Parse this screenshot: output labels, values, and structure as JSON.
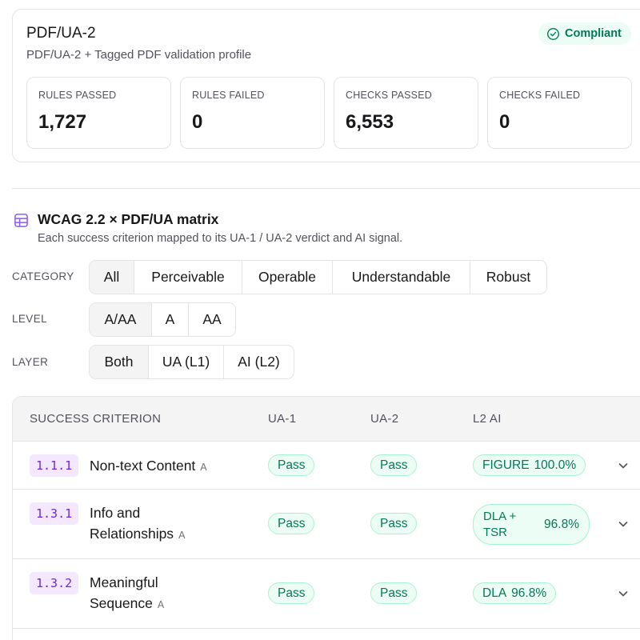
{
  "profile": {
    "title": "PDF/UA-2",
    "subtitle": "PDF/UA-2 + Tagged PDF validation profile",
    "status": "Compliant",
    "stats": [
      {
        "label": "RULES PASSED",
        "value": "1,727"
      },
      {
        "label": "RULES FAILED",
        "value": "0"
      },
      {
        "label": "CHECKS PASSED",
        "value": "6,553"
      },
      {
        "label": "CHECKS FAILED",
        "value": "0"
      }
    ]
  },
  "matrix": {
    "title": "WCAG 2.2 × PDF/UA matrix",
    "subtitle": "Each success criterion mapped to its UA-1 / UA-2 verdict and AI signal."
  },
  "filters": {
    "category": {
      "label": "CATEGORY",
      "options": [
        "All",
        "Perceivable",
        "Operable",
        "Understandable",
        "Robust"
      ],
      "selected": "All"
    },
    "level": {
      "label": "LEVEL",
      "options": [
        "A/AA",
        "A",
        "AA"
      ],
      "selected": "A/AA"
    },
    "layer": {
      "label": "LAYER",
      "options": [
        "Both",
        "UA (L1)",
        "AI (L2)"
      ],
      "selected": "Both"
    }
  },
  "table": {
    "headers": {
      "criterion": "SUCCESS CRITERION",
      "ua1": "UA-1",
      "ua2": "UA-2",
      "ai": "L2 AI"
    },
    "rows": [
      {
        "code": "1.1.1",
        "name_line1": "Non-text Content",
        "name_line2": "",
        "level": "A",
        "ua1": "Pass",
        "ua2": "Pass",
        "ai_tag": "FIGURE",
        "ai_score": "100.0%"
      },
      {
        "code": "1.3.1",
        "name_line1": "Info and",
        "name_line2": "Relationships",
        "level": "A",
        "ua1": "Pass",
        "ua2": "Pass",
        "ai_tag_line1": "DLA +",
        "ai_tag_line2": "TSR",
        "ai_score": "96.8%"
      },
      {
        "code": "1.3.2",
        "name_line1": "Meaningful",
        "name_line2": "Sequence",
        "level": "A",
        "ua1": "Pass",
        "ua2": "Pass",
        "ai_tag": "DLA",
        "ai_score": "96.8%"
      }
    ]
  },
  "colors": {
    "pass_green": "#047857",
    "pass_bg": "#ecfdf5",
    "code_purple": "#6d28d9",
    "code_bg": "#f3e8ff",
    "icon_purple": "#8b5cf6"
  },
  "icons": {
    "status": "check-circle-icon",
    "matrix": "table-grid-icon",
    "expand": "chevron-down-icon"
  }
}
